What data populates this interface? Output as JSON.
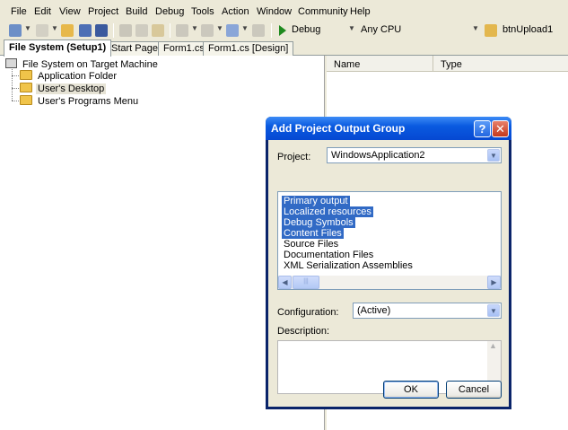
{
  "menu": [
    "File",
    "Edit",
    "View",
    "Project",
    "Build",
    "Debug",
    "Tools",
    "Action",
    "Window",
    "Community",
    "Help"
  ],
  "toolbar": {
    "configuration": "Debug",
    "platform": "Any CPU",
    "find_box": "btnUpload1"
  },
  "tabs": [
    "File System (Setup1)",
    "Start Page",
    "Form1.cs",
    "Form1.cs [Design]"
  ],
  "tree": {
    "root": "File System on Target Machine",
    "items": [
      "Application Folder",
      "User's Desktop",
      "User's Programs Menu"
    ]
  },
  "right_panel": {
    "columns": [
      "Name",
      "Type"
    ]
  },
  "dialog": {
    "title": "Add Project Output Group",
    "help_glyph": "?",
    "close_glyph": "✕",
    "project_label": "Project:",
    "project_value": "WindowsApplication2",
    "outputs": [
      {
        "label": "Primary output",
        "selected": true
      },
      {
        "label": "Localized resources",
        "selected": true
      },
      {
        "label": "Debug Symbols",
        "selected": true
      },
      {
        "label": "Content Files",
        "selected": true
      },
      {
        "label": "Source Files",
        "selected": false
      },
      {
        "label": "Documentation Files",
        "selected": false
      },
      {
        "label": "XML Serialization Assemblies",
        "selected": false
      }
    ],
    "configuration_label": "Configuration:",
    "configuration_value": "(Active)",
    "description_label": "Description:",
    "ok_label": "OK",
    "cancel_label": "Cancel"
  },
  "colors": {
    "selection": "#316ac5",
    "titlebar": "#0548d2"
  }
}
